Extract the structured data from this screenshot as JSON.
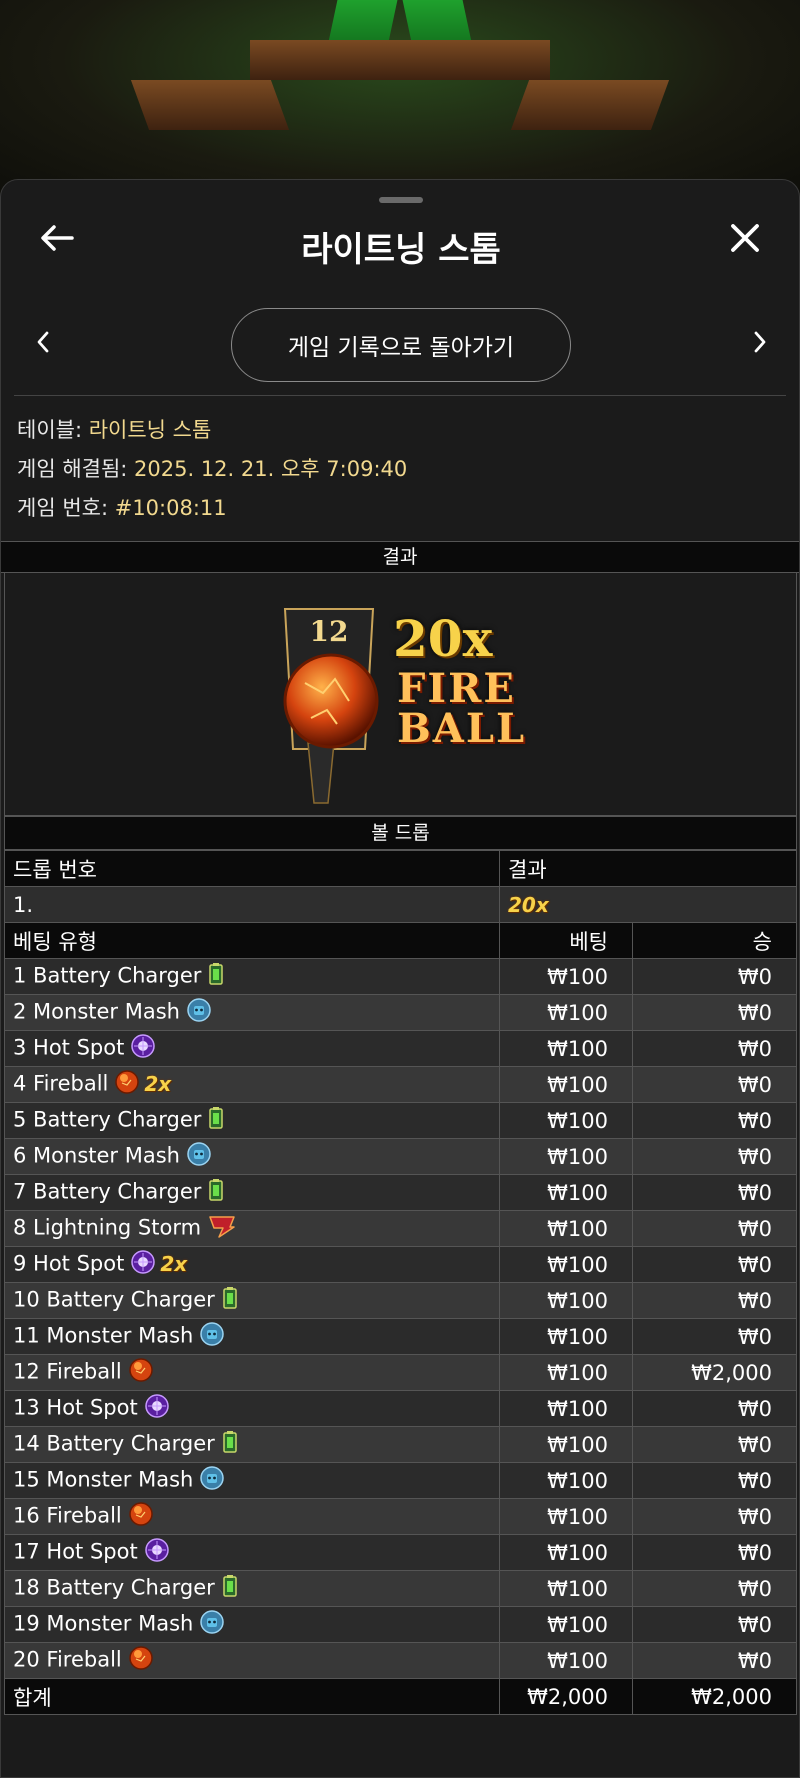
{
  "header": {
    "title": "라이트닝 스톰"
  },
  "nav": {
    "back_label": "게임 기록으로 돌아가기"
  },
  "info": {
    "table_label": "테이블: ",
    "table_value": "라이트닝 스톰",
    "resolved_label": "게임 해결됨: ",
    "resolved_value": "2025. 12. 21. 오후 7:09:40",
    "game_no_label": "게임 번호: ",
    "game_no_value": "#10:08:11"
  },
  "result": {
    "heading": "결과",
    "number": "12",
    "multiplier": "20x",
    "name_line1": "FIRE",
    "name_line2": "BALL"
  },
  "ball_drop": {
    "heading": "볼 드롭",
    "col_drop": "드롭 번호",
    "col_result": "결과",
    "rows": [
      {
        "drop": "1.",
        "result": "20x"
      }
    ]
  },
  "bets": {
    "col_type": "베팅 유형",
    "col_bet": "베팅",
    "col_win": "승",
    "rows": [
      {
        "label": "1 Battery Charger",
        "icon": "battery-icon",
        "mult": "",
        "bet": "₩100",
        "win": "₩0"
      },
      {
        "label": "2 Monster Mash",
        "icon": "monster-icon",
        "mult": "",
        "bet": "₩100",
        "win": "₩0"
      },
      {
        "label": "3 Hot Spot",
        "icon": "hotspot-icon",
        "mult": "",
        "bet": "₩100",
        "win": "₩0"
      },
      {
        "label": "4 Fireball",
        "icon": "fireball-icon",
        "mult": "2x",
        "bet": "₩100",
        "win": "₩0"
      },
      {
        "label": "5 Battery Charger",
        "icon": "battery-icon",
        "mult": "",
        "bet": "₩100",
        "win": "₩0"
      },
      {
        "label": "6 Monster Mash",
        "icon": "monster-icon",
        "mult": "",
        "bet": "₩100",
        "win": "₩0"
      },
      {
        "label": "7 Battery Charger",
        "icon": "battery-icon",
        "mult": "",
        "bet": "₩100",
        "win": "₩0"
      },
      {
        "label": "8 Lightning Storm",
        "icon": "lightning-icon",
        "mult": "",
        "bet": "₩100",
        "win": "₩0"
      },
      {
        "label": "9 Hot Spot",
        "icon": "hotspot-icon",
        "mult": "2x",
        "bet": "₩100",
        "win": "₩0"
      },
      {
        "label": "10 Battery Charger",
        "icon": "battery-icon",
        "mult": "",
        "bet": "₩100",
        "win": "₩0"
      },
      {
        "label": "11 Monster Mash",
        "icon": "monster-icon",
        "mult": "",
        "bet": "₩100",
        "win": "₩0"
      },
      {
        "label": "12 Fireball",
        "icon": "fireball-icon",
        "mult": "",
        "bet": "₩100",
        "win": "₩2,000"
      },
      {
        "label": "13 Hot Spot",
        "icon": "hotspot-icon",
        "mult": "",
        "bet": "₩100",
        "win": "₩0"
      },
      {
        "label": "14 Battery Charger",
        "icon": "battery-icon",
        "mult": "",
        "bet": "₩100",
        "win": "₩0"
      },
      {
        "label": "15 Monster Mash",
        "icon": "monster-icon",
        "mult": "",
        "bet": "₩100",
        "win": "₩0"
      },
      {
        "label": "16 Fireball",
        "icon": "fireball-icon",
        "mult": "",
        "bet": "₩100",
        "win": "₩0"
      },
      {
        "label": "17 Hot Spot",
        "icon": "hotspot-icon",
        "mult": "",
        "bet": "₩100",
        "win": "₩0"
      },
      {
        "label": "18 Battery Charger",
        "icon": "battery-icon",
        "mult": "",
        "bet": "₩100",
        "win": "₩0"
      },
      {
        "label": "19 Monster Mash",
        "icon": "monster-icon",
        "mult": "",
        "bet": "₩100",
        "win": "₩0"
      },
      {
        "label": "20 Fireball",
        "icon": "fireball-icon",
        "mult": "",
        "bet": "₩100",
        "win": "₩0"
      }
    ],
    "total_label": "합계",
    "total_bet": "₩2,000",
    "total_win": "₩2,000"
  },
  "colors": {
    "info_value": "#f2d98f",
    "multiplier": "#f7d24a",
    "table_header": "#0a0a0a"
  }
}
